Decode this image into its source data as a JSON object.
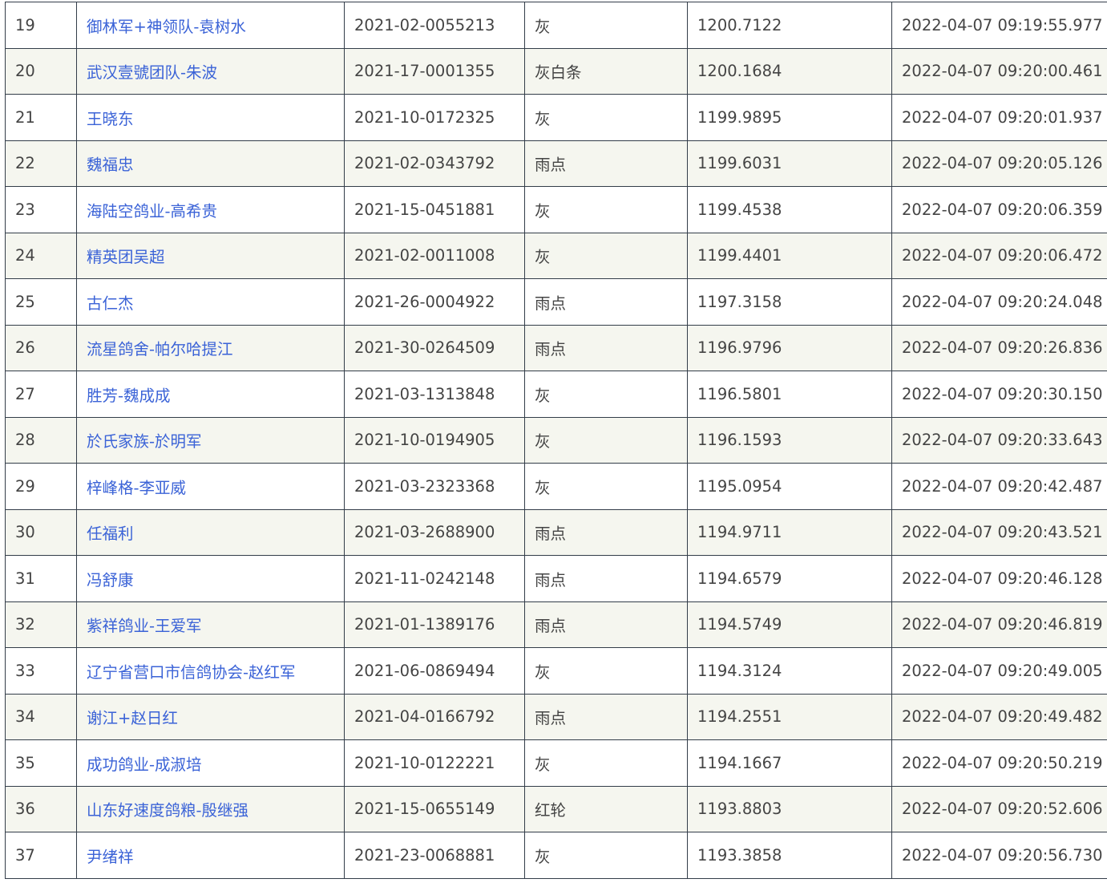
{
  "colors": {
    "link": "#3b63d7",
    "text": "#444444",
    "border": "#333d49",
    "row_alt_bg": "#f5f6ef",
    "row_bg": "#ffffff"
  },
  "rows": [
    {
      "rank": "19",
      "name": "御林军+神领队-袁树水",
      "ring": "2021-02-0055213",
      "color": "灰",
      "speed": "1200.7122",
      "time": "2022-04-07 09:19:55.977"
    },
    {
      "rank": "20",
      "name": "武汉壹號团队-朱波",
      "ring": "2021-17-0001355",
      "color": "灰白条",
      "speed": "1200.1684",
      "time": "2022-04-07 09:20:00.461"
    },
    {
      "rank": "21",
      "name": "王晓东",
      "ring": "2021-10-0172325",
      "color": "灰",
      "speed": "1199.9895",
      "time": "2022-04-07 09:20:01.937"
    },
    {
      "rank": "22",
      "name": "魏福忠",
      "ring": "2021-02-0343792",
      "color": "雨点",
      "speed": "1199.6031",
      "time": "2022-04-07 09:20:05.126"
    },
    {
      "rank": "23",
      "name": "海陆空鸽业-高希贵",
      "ring": "2021-15-0451881",
      "color": "灰",
      "speed": "1199.4538",
      "time": "2022-04-07 09:20:06.359"
    },
    {
      "rank": "24",
      "name": "精英团吴超",
      "ring": "2021-02-0011008",
      "color": "灰",
      "speed": "1199.4401",
      "time": "2022-04-07 09:20:06.472"
    },
    {
      "rank": "25",
      "name": "古仁杰",
      "ring": "2021-26-0004922",
      "color": "雨点",
      "speed": "1197.3158",
      "time": "2022-04-07 09:20:24.048"
    },
    {
      "rank": "26",
      "name": "流星鸽舍-帕尔哈提江",
      "ring": "2021-30-0264509",
      "color": "雨点",
      "speed": "1196.9796",
      "time": "2022-04-07 09:20:26.836"
    },
    {
      "rank": "27",
      "name": "胜芳-魏成成",
      "ring": "2021-03-1313848",
      "color": "灰",
      "speed": "1196.5801",
      "time": "2022-04-07 09:20:30.150"
    },
    {
      "rank": "28",
      "name": "於氏家族-於明军",
      "ring": "2021-10-0194905",
      "color": "灰",
      "speed": "1196.1593",
      "time": "2022-04-07 09:20:33.643"
    },
    {
      "rank": "29",
      "name": "梓峰格-李亚威",
      "ring": "2021-03-2323368",
      "color": "灰",
      "speed": "1195.0954",
      "time": "2022-04-07 09:20:42.487"
    },
    {
      "rank": "30",
      "name": "任福利",
      "ring": "2021-03-2688900",
      "color": "雨点",
      "speed": "1194.9711",
      "time": "2022-04-07 09:20:43.521"
    },
    {
      "rank": "31",
      "name": "冯舒康",
      "ring": "2021-11-0242148",
      "color": "雨点",
      "speed": "1194.6579",
      "time": "2022-04-07 09:20:46.128"
    },
    {
      "rank": "32",
      "name": "紫祥鸽业-王爱军",
      "ring": "2021-01-1389176",
      "color": "雨点",
      "speed": "1194.5749",
      "time": "2022-04-07 09:20:46.819"
    },
    {
      "rank": "33",
      "name": "辽宁省营口市信鸽协会-赵红军",
      "ring": "2021-06-0869494",
      "color": "灰",
      "speed": "1194.3124",
      "time": "2022-04-07 09:20:49.005"
    },
    {
      "rank": "34",
      "name": "谢江+赵日红",
      "ring": "2021-04-0166792",
      "color": "雨点",
      "speed": "1194.2551",
      "time": "2022-04-07 09:20:49.482"
    },
    {
      "rank": "35",
      "name": "成功鸽业-成淑培",
      "ring": "2021-10-0122221",
      "color": "灰",
      "speed": "1194.1667",
      "time": "2022-04-07 09:20:50.219"
    },
    {
      "rank": "36",
      "name": "山东好速度鸽粮-殷继强",
      "ring": "2021-15-0655149",
      "color": "红轮",
      "speed": "1193.8803",
      "time": "2022-04-07 09:20:52.606"
    },
    {
      "rank": "37",
      "name": "尹绪祥",
      "ring": "2021-23-0068881",
      "color": "灰",
      "speed": "1193.3858",
      "time": "2022-04-07 09:20:56.730"
    }
  ]
}
